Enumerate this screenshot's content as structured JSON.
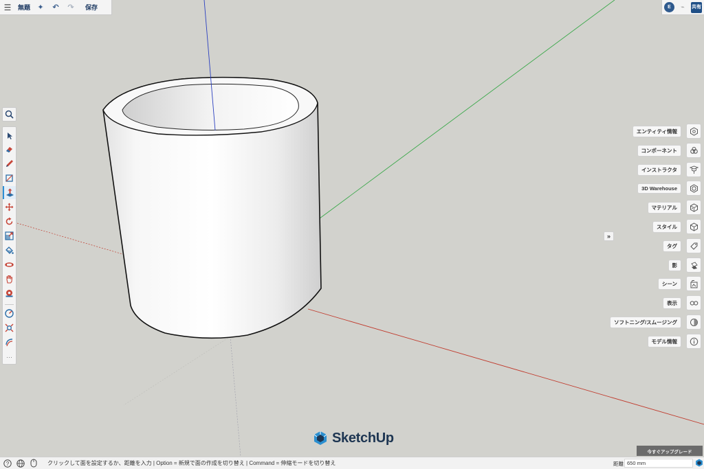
{
  "app": {
    "title": "無題",
    "save_label": "保存",
    "user_initial": "E",
    "share_label": "共有"
  },
  "topbar_icons": [
    "menu-icon",
    "sparkle-icon",
    "undo-icon",
    "redo-icon"
  ],
  "tools": [
    {
      "name": "select-tool-icon",
      "color": "#2c4a73"
    },
    {
      "name": "eraser-tool-icon",
      "color": "#c7473a"
    },
    {
      "name": "pencil-tool-icon",
      "color": "#c7473a"
    },
    {
      "name": "rectangle-tool-icon",
      "color": "#2c6ea8"
    },
    {
      "name": "push-pull-tool-icon",
      "color": "#2c6ea8"
    },
    {
      "name": "move-tool-icon",
      "color": "#c7473a"
    },
    {
      "name": "rotate-tool-icon",
      "color": "#c7473a"
    },
    {
      "name": "scale-tool-icon",
      "color": "#2c6ea8"
    },
    {
      "name": "paint-bucket-tool-icon",
      "color": "#2c6ea8"
    },
    {
      "name": "orbit-tool-icon",
      "color": "#c7473a"
    },
    {
      "name": "pan-tool-icon",
      "color": "#c7473a"
    },
    {
      "name": "tape-measure-tool-icon",
      "color": "#c7473a"
    },
    {
      "name": "protractor-tool-icon",
      "color": "#2c6ea8"
    },
    {
      "name": "zoom-extents-tool-icon",
      "color": "#c7473a"
    },
    {
      "name": "section-plane-tool-icon",
      "color": "#2c6ea8"
    }
  ],
  "more_tools_label": "···",
  "panels": [
    {
      "label": "エンティティ情報",
      "icon": "entity-info-icon"
    },
    {
      "label": "コンポーネント",
      "icon": "components-icon"
    },
    {
      "label": "インストラクタ",
      "icon": "instructor-icon"
    },
    {
      "label": "3D Warehouse",
      "icon": "warehouse-icon"
    },
    {
      "label": "マテリアル",
      "icon": "materials-icon"
    },
    {
      "label": "スタイル",
      "icon": "styles-icon"
    },
    {
      "label": "タグ",
      "icon": "tags-icon"
    },
    {
      "label": "影",
      "icon": "shadows-icon"
    },
    {
      "label": "シーン",
      "icon": "scenes-icon"
    },
    {
      "label": "表示",
      "icon": "display-icon"
    },
    {
      "label": "ソフトニング/スムージング",
      "icon": "soften-smooth-icon"
    },
    {
      "label": "モデル情報",
      "icon": "model-info-icon"
    }
  ],
  "collapse_label": "»",
  "logo_text": "SketchUp",
  "upgrade_label": "今すぐアップグレード",
  "status": {
    "hint": "クリックして面を設定するか、距離を入力 | Option = 新規で面の作成を切り替え | Command = 伸縮モードを切り替え",
    "measurement_label": "距離",
    "measurement_value": "650 mm"
  },
  "colors": {
    "accent": "#2d8fd5",
    "axis_red": "#c0392b",
    "axis_green": "#3aa84a",
    "axis_blue": "#2a3fc0",
    "canvas": "#d2d2cd"
  }
}
